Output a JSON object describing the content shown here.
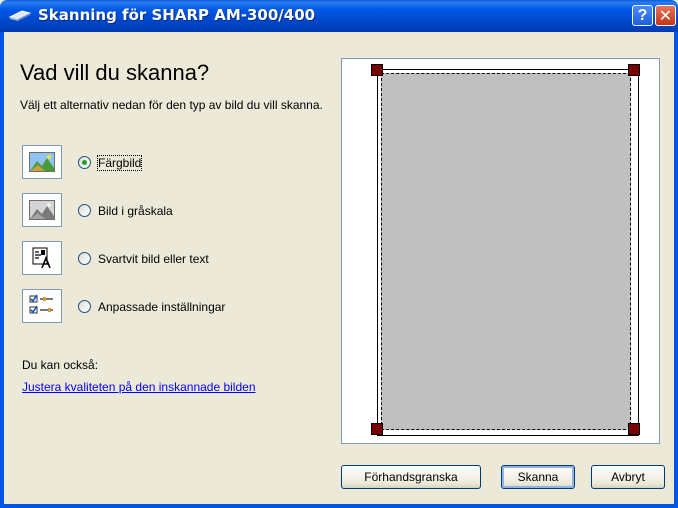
{
  "window": {
    "title": "Skanning för SHARP AM-300/400",
    "help_label": "?",
    "close_label": "✕"
  },
  "main": {
    "heading": "Vad vill du skanna?",
    "instruction": "Välj ett alternativ nedan för den typ av bild du vill skanna.",
    "options": [
      {
        "label": "Färgbild",
        "selected": true,
        "icon": "color-picture-icon"
      },
      {
        "label": "Bild i gråskala",
        "selected": false,
        "icon": "grayscale-picture-icon"
      },
      {
        "label": "Svartvit bild eller text",
        "selected": false,
        "icon": "black-white-text-icon"
      },
      {
        "label": "Anpassade inställningar",
        "selected": false,
        "icon": "custom-settings-icon"
      }
    ],
    "also_label": "Du kan också:",
    "adjust_link": "Justera kvaliteten på den inskannade bilden"
  },
  "buttons": {
    "preview": "Förhandsgranska",
    "scan": "Skanna",
    "cancel": "Avbryt"
  },
  "colors": {
    "titlebar": "#0054e3",
    "handle": "#7a0000",
    "scan_area": "#c0c0c0",
    "link": "#0000ff"
  }
}
